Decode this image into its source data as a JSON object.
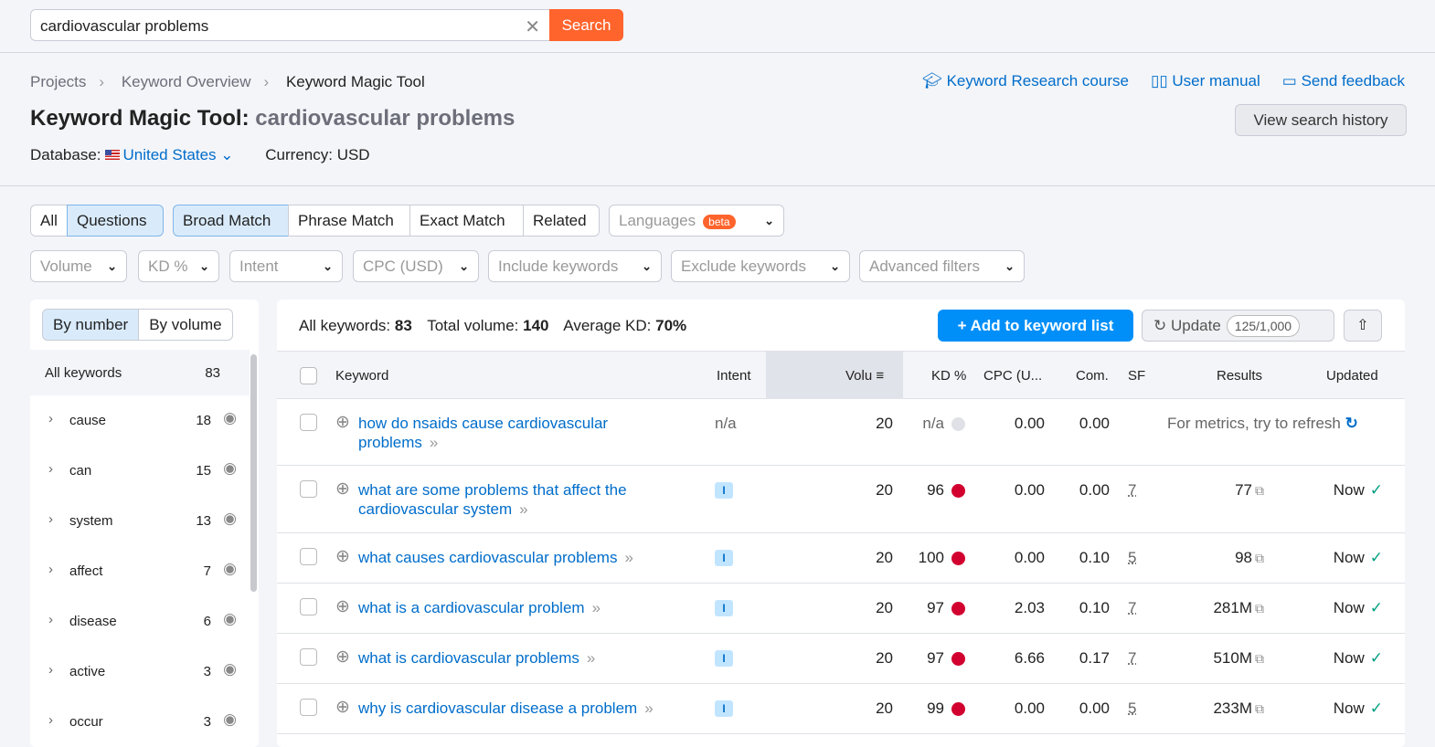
{
  "search": {
    "value": "cardiovascular problems",
    "clear": "✕",
    "button": "Search"
  },
  "breadcrumb": [
    "Projects",
    "Keyword Overview",
    "Keyword Magic Tool"
  ],
  "links": {
    "course": "Keyword Research course",
    "manual": "User manual",
    "feedback": "Send feedback"
  },
  "title": {
    "main": "Keyword Magic Tool:",
    "query": "cardiovascular problems"
  },
  "database": {
    "label": "Database:",
    "value": "United States",
    "currency": "Currency: USD"
  },
  "history_button": "View search history",
  "tabs": {
    "all": "All",
    "questions": "Questions",
    "broad": "Broad Match",
    "phrase": "Phrase Match",
    "exact": "Exact Match",
    "related": "Related",
    "languages": "Languages",
    "beta": "beta"
  },
  "filters": [
    "Volume",
    "KD %",
    "Intent",
    "CPC (USD)",
    "Include keywords",
    "Exclude keywords",
    "Advanced filters"
  ],
  "sidebar": {
    "by_number": "By number",
    "by_volume": "By volume",
    "all_label": "All keywords",
    "all_count": "83",
    "items": [
      {
        "label": "cause",
        "count": "18"
      },
      {
        "label": "can",
        "count": "15"
      },
      {
        "label": "system",
        "count": "13"
      },
      {
        "label": "affect",
        "count": "7"
      },
      {
        "label": "disease",
        "count": "6"
      },
      {
        "label": "active",
        "count": "3"
      },
      {
        "label": "occur",
        "count": "3"
      }
    ]
  },
  "stats": {
    "all_label": "All keywords:",
    "all": "83",
    "vol_label": "Total volume:",
    "vol": "140",
    "kd_label": "Average KD:",
    "kd": "70%"
  },
  "actions": {
    "add": "+  Add to keyword list",
    "update": "Update",
    "quota": "125/1,000"
  },
  "columns": {
    "keyword": "Keyword",
    "intent": "Intent",
    "volume": "Volu",
    "kd": "KD %",
    "cpc": "CPC (U...",
    "com": "Com.",
    "sf": "SF",
    "results": "Results",
    "updated": "Updated"
  },
  "rows": [
    {
      "keyword": "how do nsaids cause cardiovascular problems",
      "intent": "n/a",
      "volume": "20",
      "kd": "n/a",
      "cpc": "0.00",
      "com": "0.00",
      "sf": "",
      "results": "For metrics, try to refresh",
      "updated": ""
    },
    {
      "keyword": "what are some problems that affect the cardiovascular system",
      "intent": "I",
      "volume": "20",
      "kd": "96",
      "cpc": "0.00",
      "com": "0.00",
      "sf": "7",
      "results": "77",
      "updated": "Now"
    },
    {
      "keyword": "what causes cardiovascular problems",
      "intent": "I",
      "volume": "20",
      "kd": "100",
      "cpc": "0.00",
      "com": "0.10",
      "sf": "5",
      "results": "98",
      "updated": "Now"
    },
    {
      "keyword": "what is a cardiovascular problem",
      "intent": "I",
      "volume": "20",
      "kd": "97",
      "cpc": "2.03",
      "com": "0.10",
      "sf": "7",
      "results": "281M",
      "updated": "Now"
    },
    {
      "keyword": "what is cardiovascular problems",
      "intent": "I",
      "volume": "20",
      "kd": "97",
      "cpc": "6.66",
      "com": "0.17",
      "sf": "7",
      "results": "510M",
      "updated": "Now"
    },
    {
      "keyword": "why is cardiovascular disease a problem",
      "intent": "I",
      "volume": "20",
      "kd": "99",
      "cpc": "0.00",
      "com": "0.00",
      "sf": "5",
      "results": "233M",
      "updated": "Now"
    }
  ]
}
